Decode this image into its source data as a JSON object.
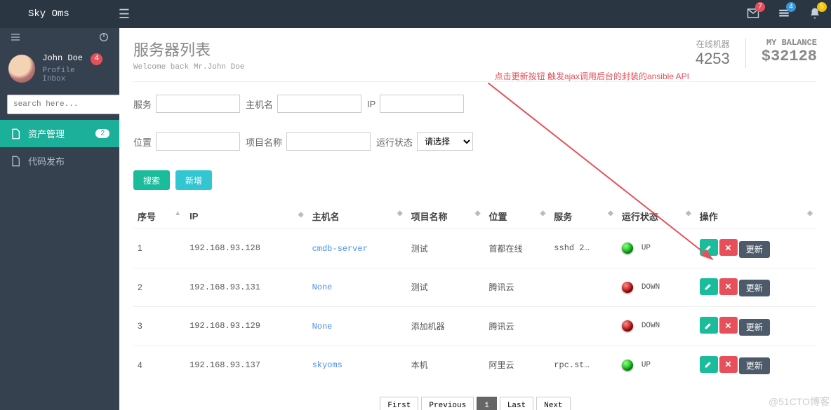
{
  "brand": "Sky Oms",
  "top_badges": {
    "mail": "7",
    "env": "4",
    "bell": "5"
  },
  "user": {
    "name": "John Doe",
    "badge": "4",
    "profile": "Profile",
    "inbox": "Inbox"
  },
  "search": {
    "placeholder": "search here..."
  },
  "sidebar": {
    "items": [
      {
        "label": "资产管理",
        "badge": "2"
      },
      {
        "label": "代码发布"
      }
    ]
  },
  "page": {
    "title": "服务器列表",
    "subtitle": "Welcome back Mr.John Doe",
    "online_label": "在线机器",
    "online_value": "4253",
    "balance_label": "MY BALANCE",
    "balance_value": "$32128"
  },
  "filters": {
    "service": "服务",
    "hostname": "主机名",
    "ip": "IP",
    "position": "位置",
    "project": "项目名称",
    "status": "运行状态",
    "status_placeholder": "请选择",
    "search_btn": "搜索",
    "add_btn": "新增"
  },
  "columns": {
    "idx": "序号",
    "ip": "IP",
    "host": "主机名",
    "project": "项目名称",
    "pos": "位置",
    "svc": "服务",
    "status": "运行状态",
    "op": "操作"
  },
  "status_labels": {
    "up": "UP",
    "down": "DOWN"
  },
  "op_update_label": "更新",
  "rows": [
    {
      "idx": "1",
      "ip": "192.168.93.128",
      "host": "cmdb-server",
      "project": "测试",
      "pos": "首都在线",
      "svc": "sshd 2…",
      "status": "up"
    },
    {
      "idx": "2",
      "ip": "192.168.93.131",
      "host": "None",
      "project": "测试",
      "pos": "腾讯云",
      "svc": "",
      "status": "down"
    },
    {
      "idx": "3",
      "ip": "192.168.93.129",
      "host": "None",
      "project": "添加机器",
      "pos": "腾讯云",
      "svc": "",
      "status": "down"
    },
    {
      "idx": "4",
      "ip": "192.168.93.137",
      "host": "skyoms",
      "project": "本机",
      "pos": "阿里云",
      "svc": "rpc.st…",
      "status": "up"
    }
  ],
  "pager": {
    "first": "First",
    "prev": "Previous",
    "page": "1",
    "last": "Last",
    "next": "Next"
  },
  "annotation": "点击更新按钮 触发ajax调用后台的封装的ansible API",
  "watermark": "@51CTO博客"
}
